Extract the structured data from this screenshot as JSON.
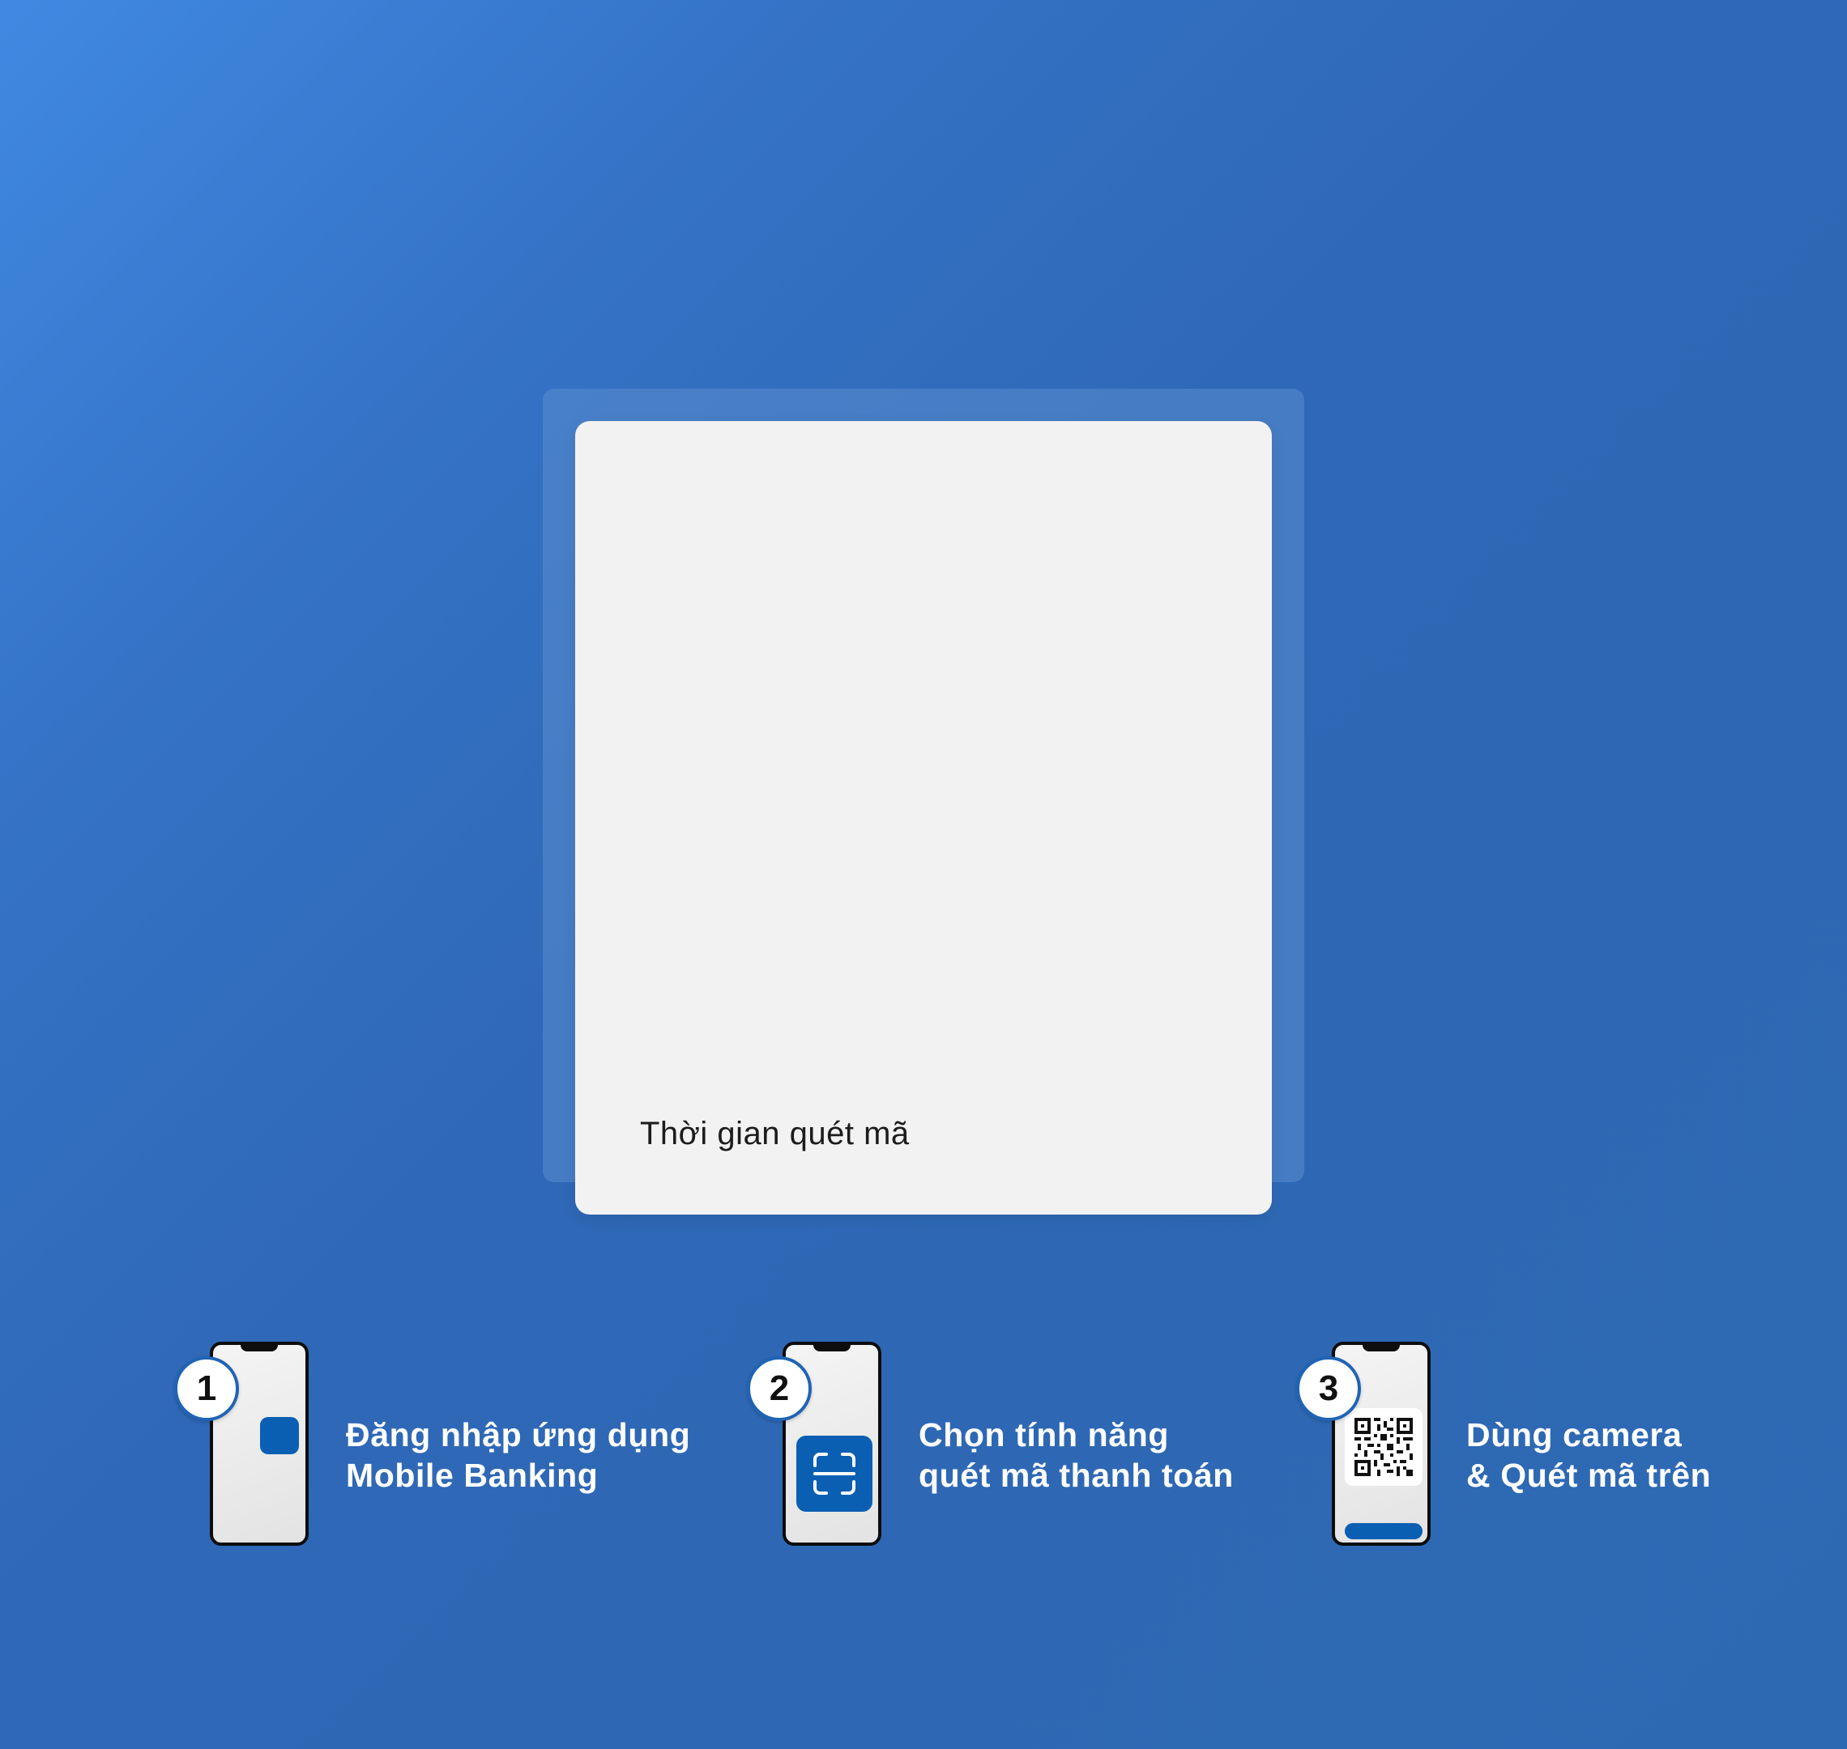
{
  "qr_panel": {
    "timer_label": "Thời gian quét mã"
  },
  "steps": [
    {
      "number": "1",
      "line1": "Đăng nhập ứng dụng",
      "line2": "Mobile Banking",
      "illustration": "phone-with-app-icon"
    },
    {
      "number": "2",
      "line1": "Chọn tính năng",
      "line2": "quét mã thanh toán",
      "illustration": "phone-with-scan-icon"
    },
    {
      "number": "3",
      "line1": "Dùng camera",
      "line2": "& Quét mã trên",
      "illustration": "phone-with-qr-code-icon"
    }
  ],
  "colors": {
    "background_start": "#4089e2",
    "background_end": "#2d69b3",
    "panel": "#f2f2f2",
    "accent": "#0b5fb3",
    "badge_border": "#1f64b5",
    "step_text": "#ffffff"
  }
}
